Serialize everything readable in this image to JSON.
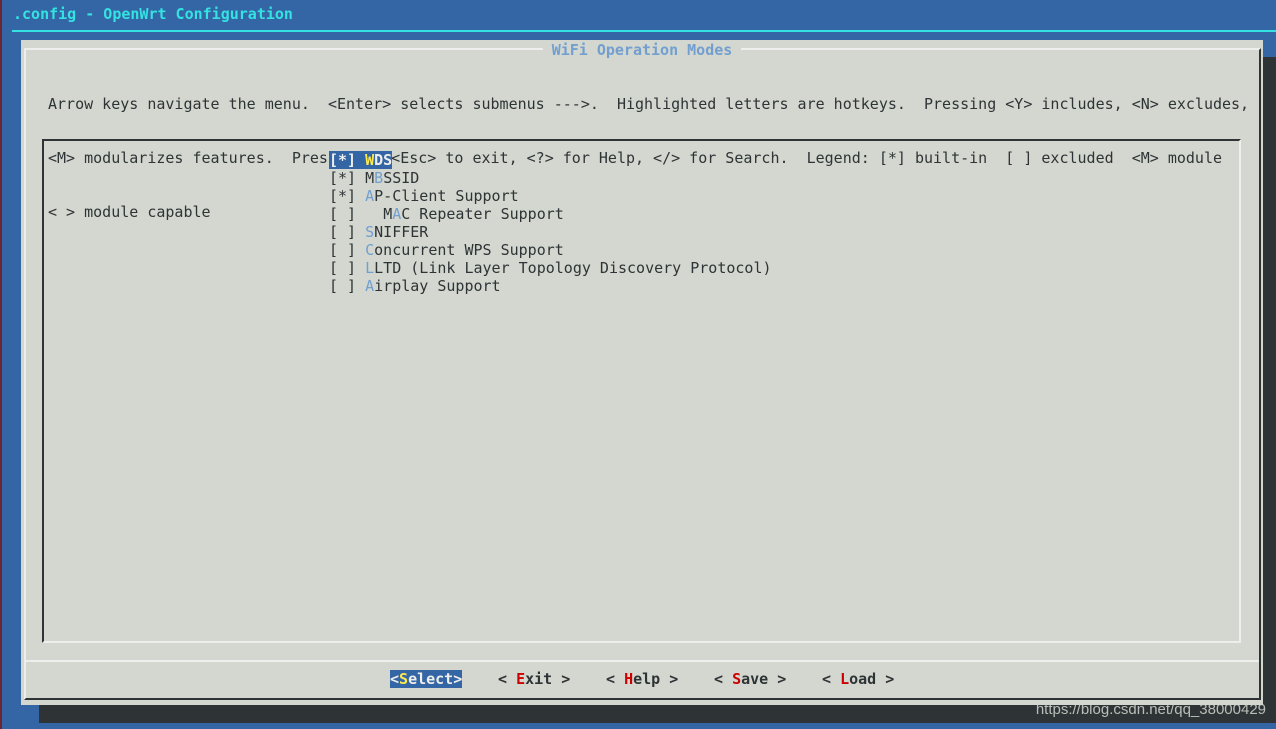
{
  "window": {
    "title": ".config - OpenWrt Configuration"
  },
  "dialog": {
    "title": "WiFi Operation Modes",
    "help_lines": [
      "Arrow keys navigate the menu.  <Enter> selects submenus --->.  Highlighted letters are hotkeys.  Pressing <Y> includes, <N> excludes,",
      "<M> modularizes features.  Press <Esc><Esc> to exit, <?> for Help, </> for Search.  Legend: [*] built-in  [ ] excluded  <M> module",
      "< > module capable"
    ],
    "items": [
      {
        "state": "[*]",
        "indent": "",
        "pre": "",
        "hotkey": "W",
        "rest": "DS",
        "selected": true
      },
      {
        "state": "[*]",
        "indent": "",
        "pre": "M",
        "hotkey": "B",
        "rest": "SSID",
        "selected": false
      },
      {
        "state": "[*]",
        "indent": "",
        "pre": "",
        "hotkey": "A",
        "rest": "P-Client Support",
        "selected": false
      },
      {
        "state": "[ ]",
        "indent": "  ",
        "pre": "M",
        "hotkey": "A",
        "rest": "C Repeater Support",
        "selected": false
      },
      {
        "state": "[ ]",
        "indent": "",
        "pre": "",
        "hotkey": "S",
        "rest": "NIFFER",
        "selected": false
      },
      {
        "state": "[ ]",
        "indent": "",
        "pre": "",
        "hotkey": "C",
        "rest": "oncurrent WPS Support",
        "selected": false
      },
      {
        "state": "[ ]",
        "indent": "",
        "pre": "",
        "hotkey": "L",
        "rest": "LTD (Link Layer Topology Discovery Protocol)",
        "selected": false
      },
      {
        "state": "[ ]",
        "indent": "",
        "pre": "",
        "hotkey": "A",
        "rest": "irplay Support",
        "selected": false
      }
    ],
    "buttons": [
      {
        "pre": "<",
        "hotkey": "S",
        "rest": "elect>",
        "selected": true
      },
      {
        "pre": "< ",
        "hotkey": "E",
        "rest": "xit >",
        "selected": false
      },
      {
        "pre": "< ",
        "hotkey": "H",
        "rest": "elp >",
        "selected": false
      },
      {
        "pre": "< ",
        "hotkey": "S",
        "rest": "ave >",
        "selected": false
      },
      {
        "pre": "< ",
        "hotkey": "L",
        "rest": "oad >",
        "selected": false
      }
    ]
  },
  "watermark": "https://blog.csdn.net/qq_38000429",
  "colors": {
    "background": "#3465a4",
    "dialog": "#d3d7cf",
    "hotkey": "#729fcf",
    "button_hotkey": "#cc0000",
    "selected_hotkey": "#fce94f",
    "title": "#34e2e2"
  }
}
